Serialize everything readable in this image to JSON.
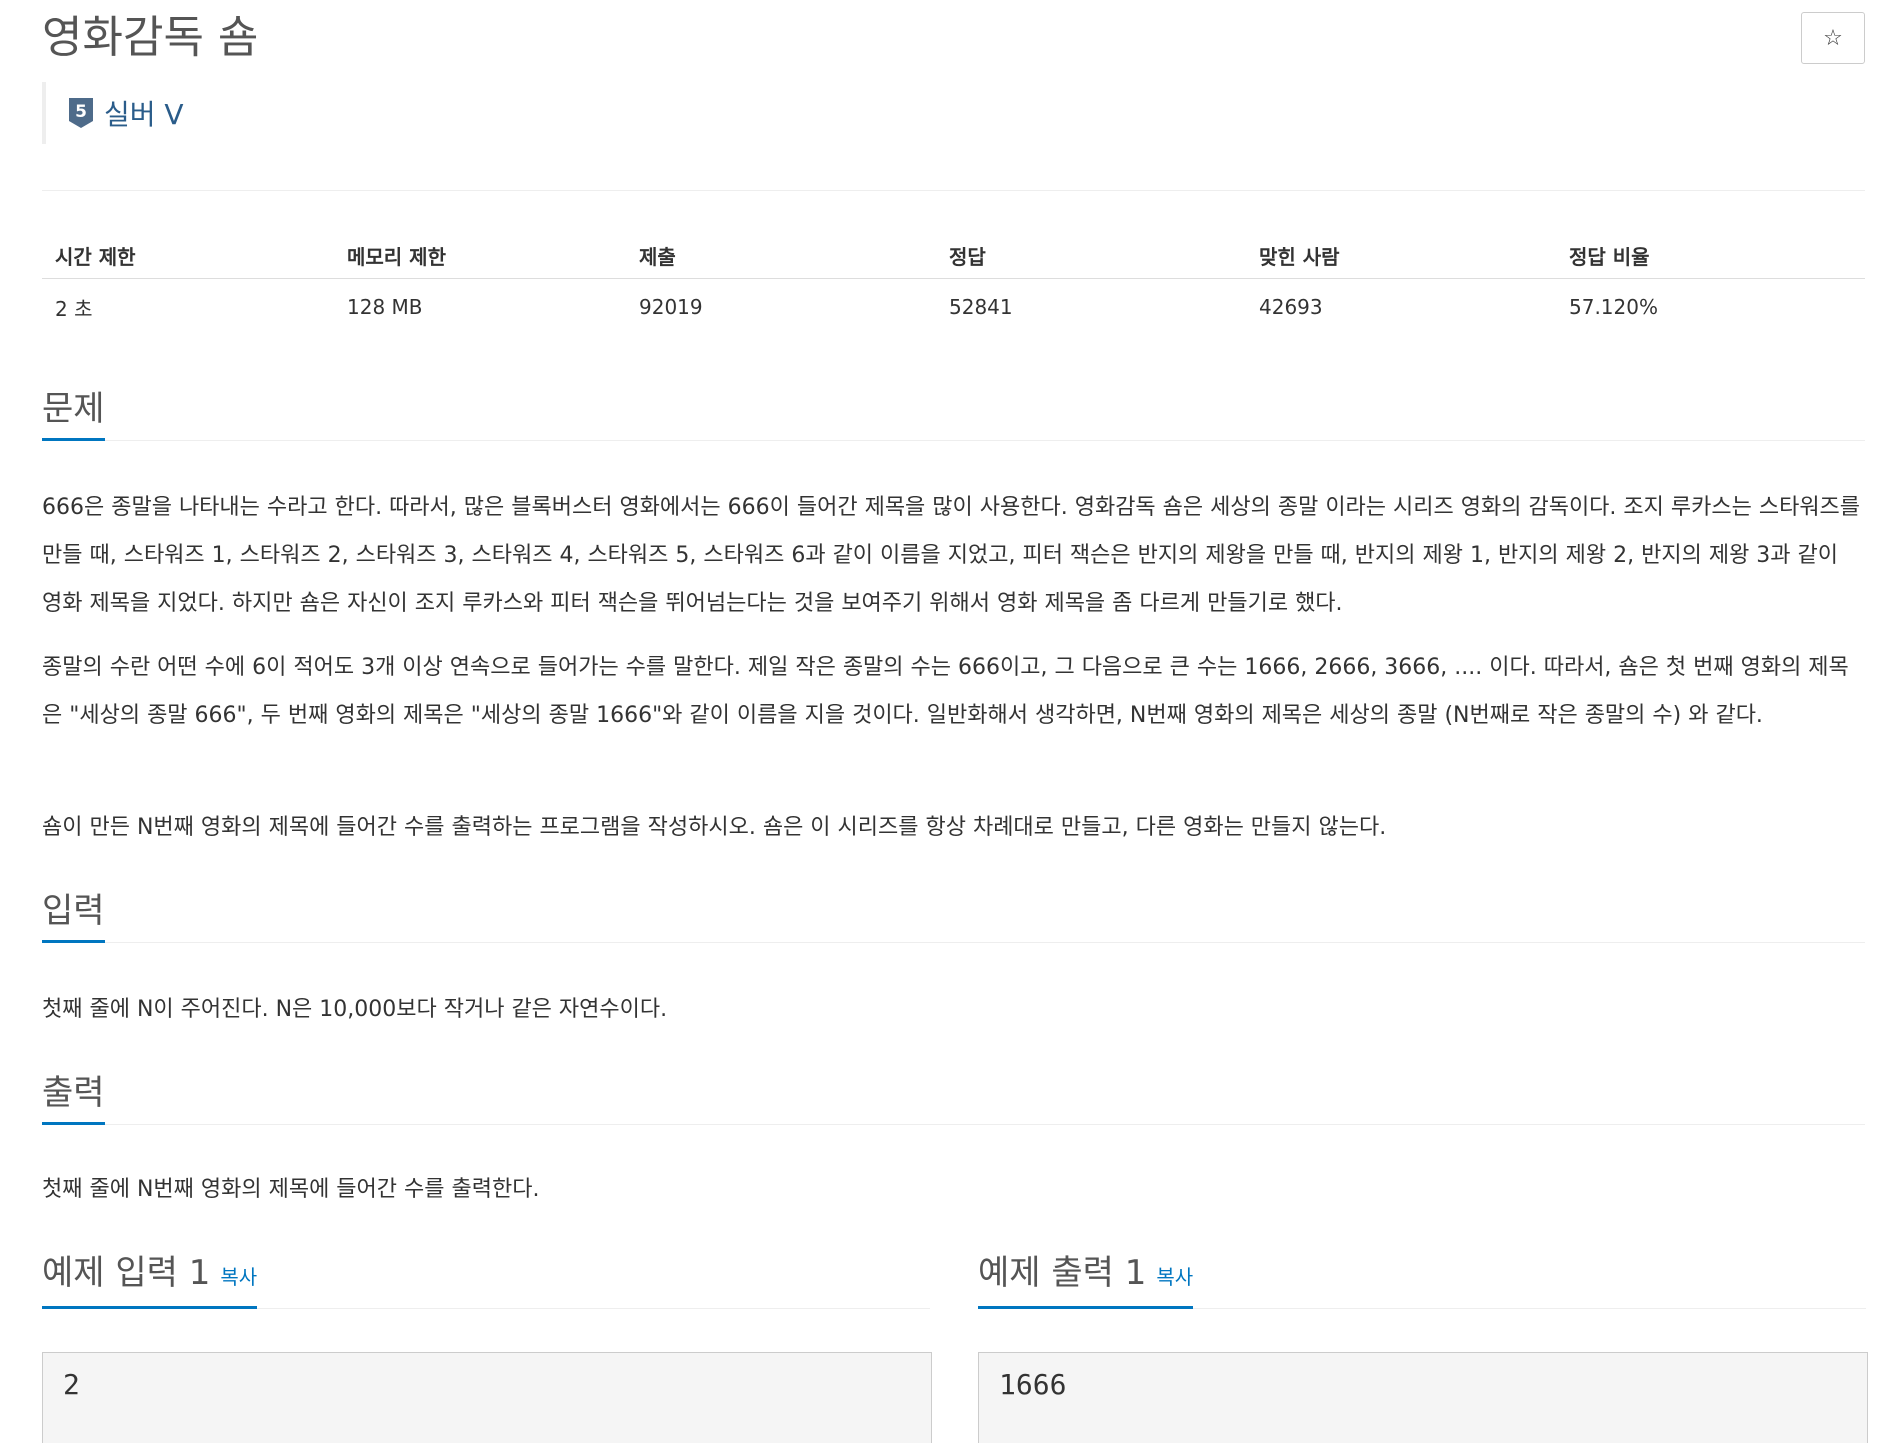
{
  "problem": {
    "title": "영화감독 숌",
    "star_icon": "★",
    "tier": {
      "number": "5",
      "label": "실버 V",
      "color": "#4e6b8a"
    }
  },
  "stats": {
    "headers": [
      "시간 제한",
      "메모리 제한",
      "제출",
      "정답",
      "맞힌 사람",
      "정답 비율"
    ],
    "values": [
      "2 초",
      "128 MB",
      "92019",
      "52841",
      "42693",
      "57.120%"
    ]
  },
  "sections": {
    "description": {
      "title": "문제",
      "paragraphs": [
        "666은 종말을 나타내는 수라고 한다. 따라서, 많은 블록버스터 영화에서는 666이 들어간 제목을 많이 사용한다. 영화감독 숌은 세상의 종말 이라는 시리즈 영화의 감독이다. 조지 루카스는 스타워즈를 만들 때, 스타워즈 1, 스타워즈 2, 스타워즈 3, 스타워즈 4, 스타워즈 5, 스타워즈 6과 같이 이름을 지었고, 피터 잭슨은 반지의 제왕을 만들 때, 반지의 제왕 1, 반지의 제왕 2, 반지의 제왕 3과 같이 영화 제목을 지었다. 하지만 숌은 자신이 조지 루카스와 피터 잭슨을 뛰어넘는다는 것을 보여주기 위해서 영화 제목을 좀 다르게 만들기로 했다.",
        "종말의 수란 어떤 수에 6이 적어도 3개 이상 연속으로 들어가는 수를 말한다. 제일 작은 종말의 수는 666이고, 그 다음으로 큰 수는 1666, 2666, 3666, .... 이다. 따라서, 숌은 첫 번째 영화의 제목은 \"세상의 종말 666\", 두 번째 영화의 제목은 \"세상의 종말 1666\"와 같이 이름을 지을 것이다. 일반화해서 생각하면, N번째 영화의 제목은 세상의 종말 (N번째로 작은 종말의 수) 와 같다.",
        "숌이 만든 N번째 영화의 제목에 들어간 수를 출력하는 프로그램을 작성하시오. 숌은 이 시리즈를 항상 차례대로 만들고, 다른 영화는 만들지 않는다."
      ]
    },
    "input": {
      "title": "입력",
      "text": "첫째 줄에 N이 주어진다. N은 10,000보다 작거나 같은 자연수이다."
    },
    "output": {
      "title": "출력",
      "text": "첫째 줄에 N번째 영화의 제목에 들어간 수를 출력한다."
    }
  },
  "samples": {
    "input": {
      "title": "예제 입력 1",
      "copy_label": "복사",
      "value": "2"
    },
    "output": {
      "title": "예제 출력 1",
      "copy_label": "복사",
      "value": "1666"
    }
  },
  "colors": {
    "accent": "#0076c0",
    "link": "#0076c0",
    "heading": "#555555"
  }
}
